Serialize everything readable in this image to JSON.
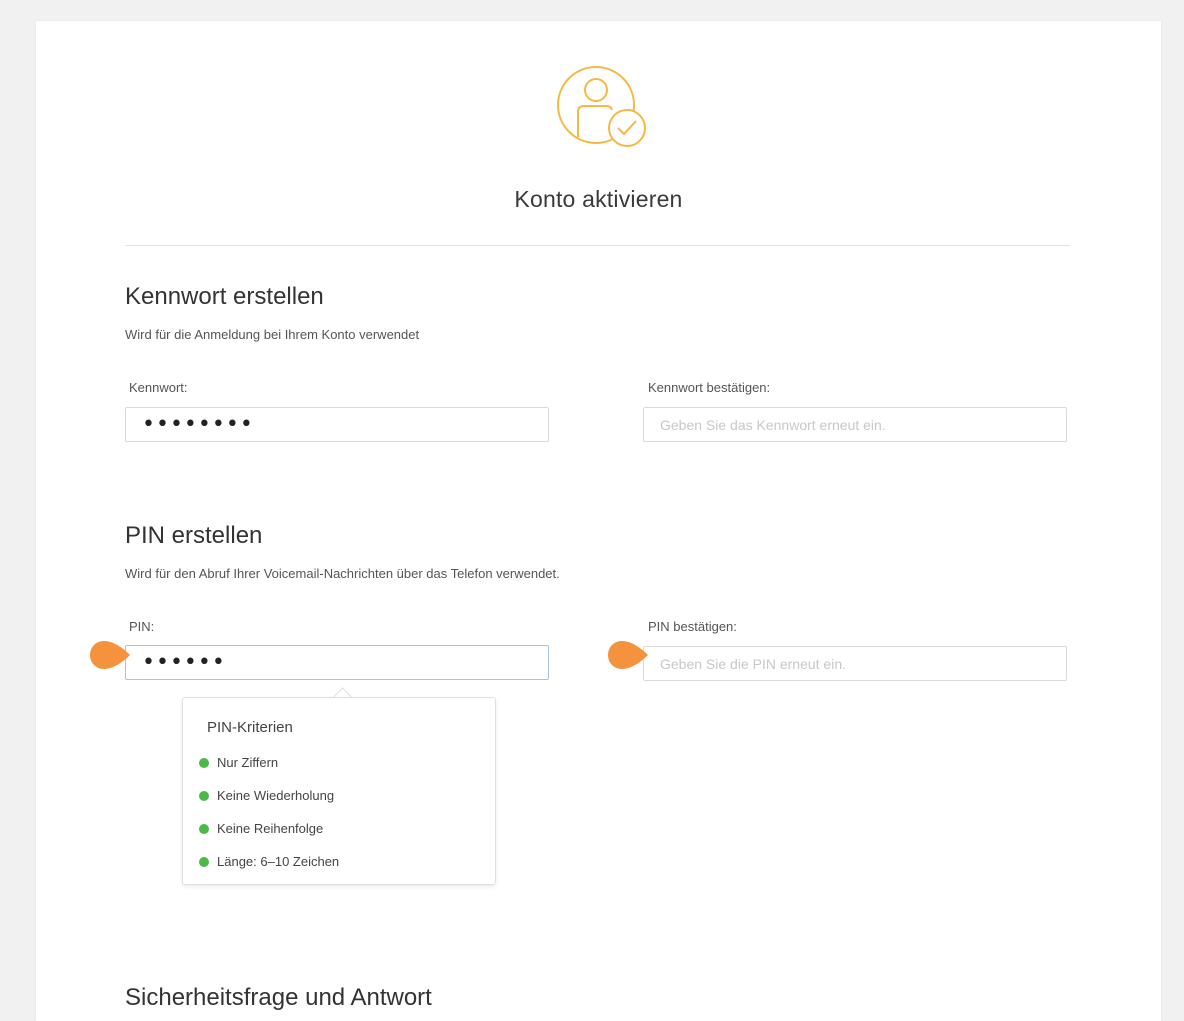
{
  "header": {
    "title": "Konto aktivieren",
    "icon": "user-check-icon"
  },
  "password_section": {
    "title": "Kennwort erstellen",
    "subtitle": "Wird für die Anmeldung bei Ihrem Konto verwendet",
    "password_label": "Kennwort:",
    "password_value": "••••••••",
    "confirm_label": "Kennwort bestätigen:",
    "confirm_placeholder": "Geben Sie das Kennwort erneut ein."
  },
  "pin_section": {
    "title": "PIN erstellen",
    "subtitle": "Wird für den Abruf Ihrer Voicemail-Nachrichten über das Telefon verwendet.",
    "pin_label": "PIN:",
    "pin_value": "••••••",
    "confirm_label": "PIN bestätigen:",
    "confirm_placeholder": "Geben Sie die PIN erneut ein."
  },
  "pin_criteria": {
    "title": "PIN-Kriterien",
    "items": [
      {
        "label": "Nur Ziffern",
        "status": "ok"
      },
      {
        "label": "Keine Wiederholung",
        "status": "ok"
      },
      {
        "label": "Keine Reihenfolge",
        "status": "ok"
      },
      {
        "label": "Länge: 6–10 Zeichen",
        "status": "ok"
      }
    ]
  },
  "security_section": {
    "title": "Sicherheitsfrage und Antwort"
  },
  "colors": {
    "accent_icon": "#f5b942",
    "marker": "#f5923e",
    "criteria_ok": "#4cb848",
    "focus_border": "#a9c4d9"
  }
}
